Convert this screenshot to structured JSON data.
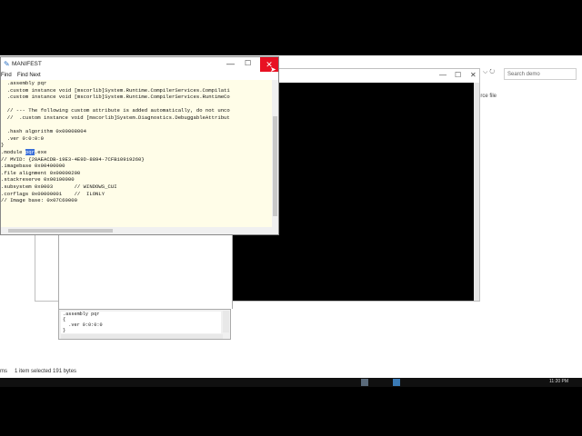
{
  "explorer": {
    "search_placeholder": "Search demo",
    "nav_glyph": "⌵  ↻",
    "side_text": "urce file",
    "status_items": "ms",
    "status_selected": "1 item selected  191 bytes"
  },
  "taskbar": {
    "clock": "11:20 PM"
  },
  "console": {
    "min": "—",
    "max": "☐",
    "close": "✕"
  },
  "info_pane": {
    "lines": ".assembly pqr\n{\n  .ver 0:0:0:0\n}"
  },
  "manifest": {
    "title": "MANIFEST",
    "min": "—",
    "max": "☐",
    "close": "✕",
    "menu": {
      "find": "Find",
      "find_next": "Find Next"
    },
    "code_lines": [
      "  .assembly pqr",
      "  .custom instance void [mscorlib]System.Runtime.CompilerServices.Compilati",
      "  .custom instance void [mscorlib]System.Runtime.CompilerServices.RuntimeCo",
      "",
      "  // --- The following custom attribute is added automatically, do not unco",
      "  //  .custom instance void [mscorlib]System.Diagnostics.DebuggableAttribut",
      "",
      "  .hash algorithm 0x00008004",
      "  .ver 0:0:0:0",
      "}"
    ],
    "module_prefix": ".module ",
    "module_name": "pqr",
    "module_suffix": ".exe",
    "code_lines_after": [
      "// MVID: {20AEACDB-19E3-4E9D-8894-7CFB10919260}",
      ".imagebase 0x00400000",
      ".file alignment 0x00000200",
      ".stackreserve 0x00100000",
      ".subsystem 0x0003       // WINDOWS_CUI",
      ".corflags 0x00000001    //  ILONLY",
      "// Image base: 0x07C60000"
    ]
  }
}
